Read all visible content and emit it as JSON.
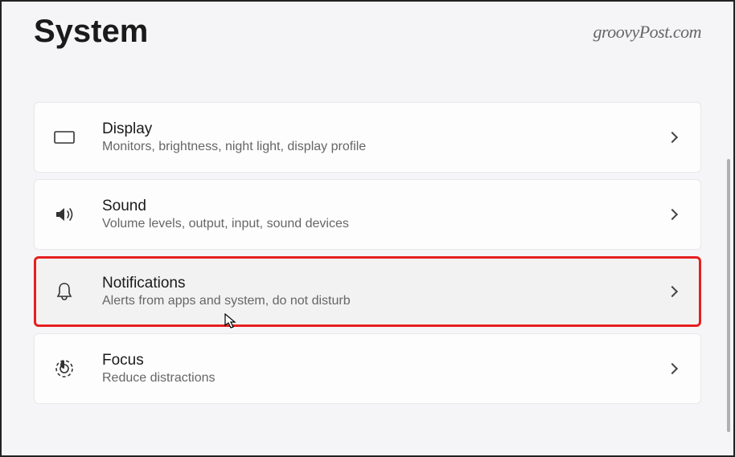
{
  "header": {
    "title": "System",
    "watermark": "groovyPost.com"
  },
  "items": [
    {
      "id": "display",
      "title": "Display",
      "subtitle": "Monitors, brightness, night light, display profile",
      "highlighted": false
    },
    {
      "id": "sound",
      "title": "Sound",
      "subtitle": "Volume levels, output, input, sound devices",
      "highlighted": false
    },
    {
      "id": "notifications",
      "title": "Notifications",
      "subtitle": "Alerts from apps and system, do not disturb",
      "highlighted": true
    },
    {
      "id": "focus",
      "title": "Focus",
      "subtitle": "Reduce distractions",
      "highlighted": false
    }
  ]
}
